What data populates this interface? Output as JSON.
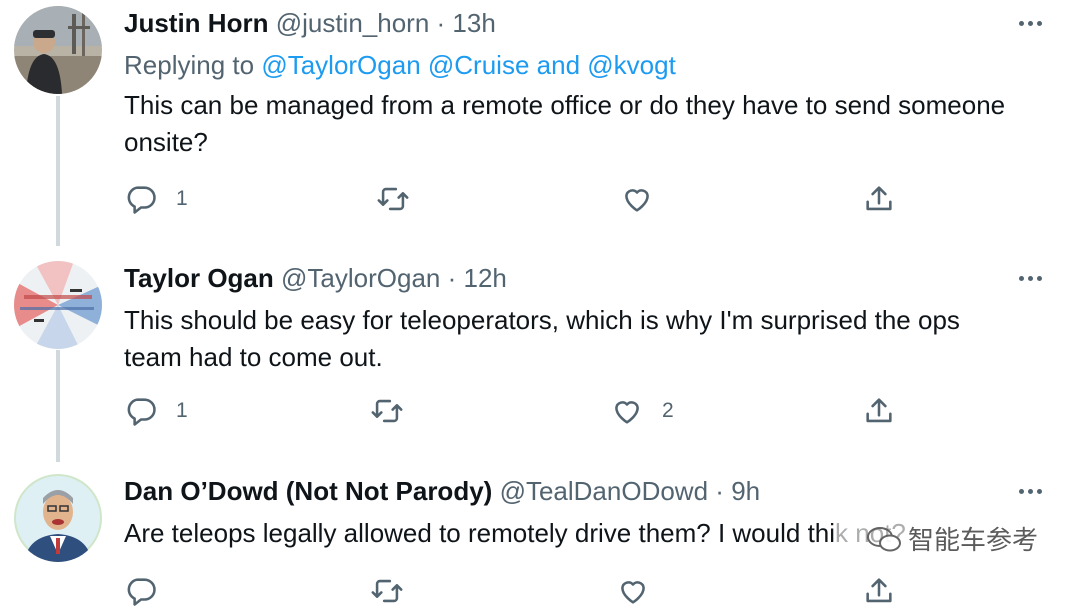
{
  "tweets": [
    {
      "name": "Justin Horn",
      "handle": "@justin_horn",
      "time": "13h",
      "replying_label": "Replying to",
      "replying_mentions": "@TaylorOgan @Cruise",
      "replying_and": "and",
      "replying_last": "@kvogt",
      "text": "This can be managed from a remote office or do they have to send someone onsite?",
      "reply_count": "1",
      "retweet_count": "",
      "like_count": ""
    },
    {
      "name": "Taylor Ogan",
      "handle": "@TaylorOgan",
      "time": "12h",
      "text": "This should be easy for teleoperators, which is why I'm surprised the ops team had to come out.",
      "reply_count": "1",
      "retweet_count": "",
      "like_count": "2"
    },
    {
      "name": "Dan O’Dowd (Not Not Parody)",
      "handle": "@TealDanODowd",
      "time": "9h",
      "text": "Are teleops legally allowed to remotely drive them? I would thi",
      "text_tail": "k not?"
    }
  ],
  "watermark": "智能车参考",
  "icons": {
    "more": "more-horizontal-icon",
    "reply": "reply-icon",
    "retweet": "retweet-icon",
    "like": "heart-icon",
    "share": "share-icon"
  },
  "colors": {
    "text": "#0f1419",
    "secondary": "#536471",
    "link": "#1d9bf0",
    "thread_line": "#cfd9de"
  }
}
